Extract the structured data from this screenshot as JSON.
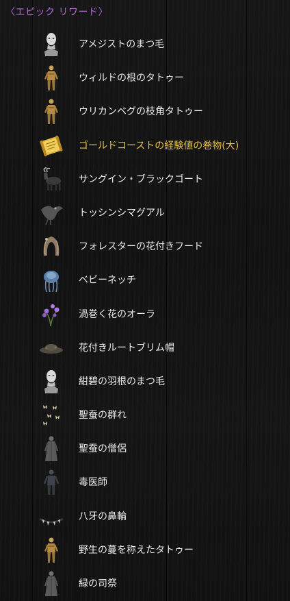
{
  "header": {
    "title": "〈エピック リワード〉"
  },
  "colors": {
    "header": "#b06ad6",
    "item_text": "#ececec",
    "highlight_text": "#e7c24a"
  },
  "items": [
    {
      "label": "アメジストのまつ毛",
      "icon": "white-bust-icon"
    },
    {
      "label": "ウィルドの根のタトゥー",
      "icon": "gold-figure-icon"
    },
    {
      "label": "ウリカンベグの枝角タトゥー",
      "icon": "gold-figure-icon"
    },
    {
      "label": "ゴールドコーストの経験値の巻物(大)",
      "icon": "gold-scroll-icon",
      "highlight": true
    },
    {
      "label": "サングイン・ブラックゴート",
      "icon": "goat-icon"
    },
    {
      "label": "トッシンシマグアル",
      "icon": "bird-creature-icon"
    },
    {
      "label": "フォレスターの花付きフード",
      "icon": "hood-icon"
    },
    {
      "label": "ベビーネッチ",
      "icon": "netch-icon"
    },
    {
      "label": "渦巻く花のオーラ",
      "icon": "purple-flower-icon"
    },
    {
      "label": "花付きルートブリム帽",
      "icon": "brim-hat-icon"
    },
    {
      "label": "紺碧の羽根のまつ毛",
      "icon": "white-bust-icon"
    },
    {
      "label": "聖蚕の群れ",
      "icon": "moths-icon"
    },
    {
      "label": "聖蚕の僧侶",
      "icon": "robed-figure-icon"
    },
    {
      "label": "毒医師",
      "icon": "dark-figure-icon"
    },
    {
      "label": "八牙の鼻輪",
      "icon": "fang-ring-icon"
    },
    {
      "label": "野生の蔓を称えたタトゥー",
      "icon": "gold-figure-icon"
    },
    {
      "label": "緑の司祭",
      "icon": "robed-figure-icon"
    }
  ]
}
